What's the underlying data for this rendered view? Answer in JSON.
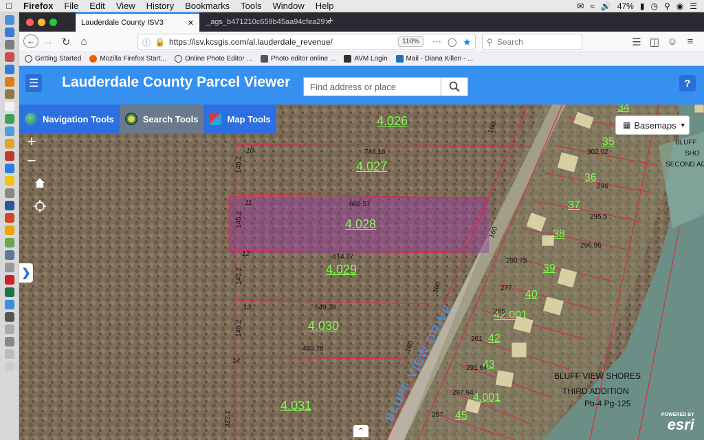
{
  "menubar": {
    "app": "Firefox",
    "items": [
      "File",
      "Edit",
      "View",
      "History",
      "Bookmarks",
      "Tools",
      "Window",
      "Help"
    ],
    "battery": "47%"
  },
  "browser": {
    "tabs": [
      {
        "title": "Lauderdale County ISV3"
      },
      {
        "title": "_ags_b471210c659b45aa94cfea29"
      }
    ],
    "url": "https://isv.kcsgis.com/al.lauderdale_revenue/",
    "zoom": "110%",
    "search_placeholder": "Search",
    "bookmarks": [
      {
        "label": "Getting Started",
        "color": "#4a4a4a"
      },
      {
        "label": "Mozilla Firefox Start...",
        "color": "#e66000"
      },
      {
        "label": "Online Photo Editor ...",
        "color": "#4a4a4a"
      },
      {
        "label": "Photo editor online ...",
        "color": "#555555"
      },
      {
        "label": "AVM Login",
        "color": "#333333"
      },
      {
        "label": "Mail - Diana Killen - ...",
        "color": "#1f6fc2"
      }
    ]
  },
  "app": {
    "title": "Lauderdale County Parcel Viewer",
    "address_placeholder": "Find address or place",
    "tools": [
      {
        "label": "Navigation Tools",
        "bg": "#2b6fe0",
        "icon": "globe-icon"
      },
      {
        "label": "Search Tools",
        "bg": "#6a7a8c",
        "icon": "compass-icon"
      },
      {
        "label": "Map Tools",
        "bg": "#2b6fe0",
        "icon": "map-pin-icon"
      }
    ],
    "basemaps_label": "Basemaps",
    "esri_powered": "POWERED BY",
    "esri_logo": "esri"
  },
  "map": {
    "parcel_labels": [
      "4.026",
      "4.027",
      "4.028",
      "4.029",
      "4.030",
      "4.031"
    ],
    "lot_numbers": [
      "10",
      "11",
      "12",
      "13",
      "14"
    ],
    "dimensions": [
      "746.16",
      "660.57",
      "614.27",
      "549.38",
      "483.79",
      "145.2",
      "145.2",
      "145.2",
      "145.2",
      "160",
      "160",
      "160",
      "160",
      "322.1"
    ],
    "right_parcels": [
      "34",
      "35",
      "36",
      "37",
      "38",
      "39",
      "40",
      "42.001",
      "42",
      "43",
      "4.001",
      "45"
    ],
    "right_dims": [
      "302.02",
      "296",
      "295.5",
      "296.96",
      "290.75",
      "277",
      "266",
      "261",
      "291.64",
      "297.94",
      "257"
    ],
    "road": "BLUFF VIEW DRIVE",
    "subdivision": [
      "BLUFF VIEW SHORES",
      "THIRD ADDITION",
      "Pb-4 Pg-125"
    ],
    "corner_labels": [
      "BLUFF",
      "SHO",
      "SECOND AD"
    ]
  }
}
